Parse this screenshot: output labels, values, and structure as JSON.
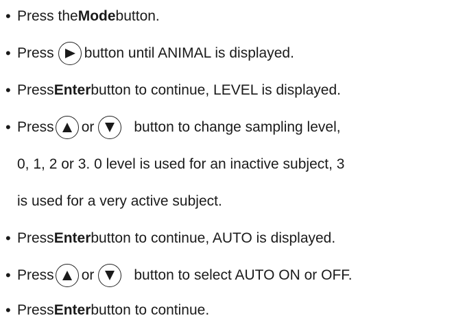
{
  "steps": [
    {
      "pre": "Press the ",
      "bold": "Mode",
      "post": " button."
    },
    {
      "pre": "Press ",
      "icon": "right-arrow",
      "post": "button until ANIMAL is displayed."
    },
    {
      "pre": "Press ",
      "bold": "Enter",
      "post": " button to continue, LEVEL is displayed."
    },
    {
      "pre": "Press ",
      "icon1": "up-arrow",
      "mid": "or",
      "icon2": "down-arrow",
      "post": "button to change sampling level,"
    },
    {
      "cont1": "0, 1, 2 or 3.  0 level is used for an inactive subject, 3"
    },
    {
      "cont2": "is used for a very active subject."
    },
    {
      "pre": "Press ",
      "bold": "Enter",
      "post": " button to continue, AUTO is displayed."
    },
    {
      "pre": "Press ",
      "icon1": "up-arrow",
      "mid": "or",
      "icon2": "down-arrow",
      "post": "button to select AUTO ON or OFF."
    },
    {
      "pre": "Press ",
      "bold": "Enter",
      "post": " button to continue."
    }
  ],
  "bullet": "•"
}
